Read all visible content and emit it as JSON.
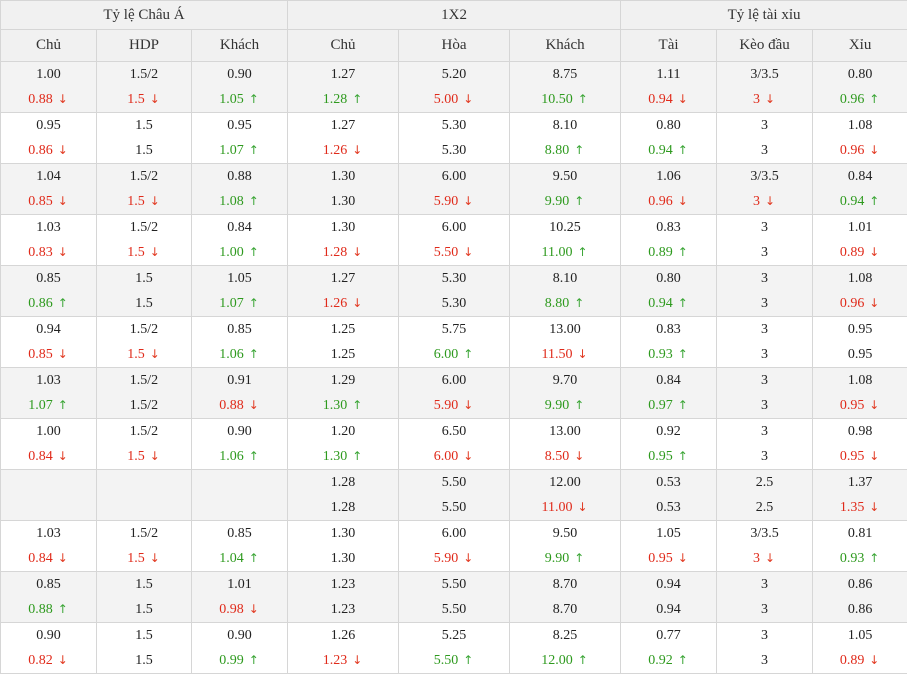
{
  "groups": [
    "Tỷ lệ Châu Á",
    "1X2",
    "Tỷ lệ tài xỉu"
  ],
  "columns": [
    "Chủ",
    "HDP",
    "Khách",
    "Chủ",
    "Hòa",
    "Khách",
    "Tài",
    "Kèo đầu",
    "Xỉu"
  ],
  "colors": {
    "up": "#2e9a1e",
    "down": "#e02a1a",
    "header_bg": "#f1f1f1",
    "row_shade": "#f3f3f3",
    "border": "#d6d6d6"
  },
  "rows": [
    {
      "cells": [
        [
          "1.00",
          "0.88",
          "down"
        ],
        [
          "1.5/2",
          "1.5",
          "down"
        ],
        [
          "0.90",
          "1.05",
          "up"
        ],
        [
          "1.27",
          "1.28",
          "up"
        ],
        [
          "5.20",
          "5.00",
          "down"
        ],
        [
          "8.75",
          "10.50",
          "up"
        ],
        [
          "1.11",
          "0.94",
          "down"
        ],
        [
          "3/3.5",
          "3",
          "down"
        ],
        [
          "0.80",
          "0.96",
          "up"
        ]
      ]
    },
    {
      "cells": [
        [
          "0.95",
          "0.86",
          "down"
        ],
        [
          "1.5",
          "1.5",
          ""
        ],
        [
          "0.95",
          "1.07",
          "up"
        ],
        [
          "1.27",
          "1.26",
          "down"
        ],
        [
          "5.30",
          "5.30",
          ""
        ],
        [
          "8.10",
          "8.80",
          "up"
        ],
        [
          "0.80",
          "0.94",
          "up"
        ],
        [
          "3",
          "3",
          ""
        ],
        [
          "1.08",
          "0.96",
          "down"
        ]
      ]
    },
    {
      "cells": [
        [
          "1.04",
          "0.85",
          "down"
        ],
        [
          "1.5/2",
          "1.5",
          "down"
        ],
        [
          "0.88",
          "1.08",
          "up"
        ],
        [
          "1.30",
          "1.30",
          ""
        ],
        [
          "6.00",
          "5.90",
          "down"
        ],
        [
          "9.50",
          "9.90",
          "up"
        ],
        [
          "1.06",
          "0.96",
          "down"
        ],
        [
          "3/3.5",
          "3",
          "down"
        ],
        [
          "0.84",
          "0.94",
          "up"
        ]
      ]
    },
    {
      "cells": [
        [
          "1.03",
          "0.83",
          "down"
        ],
        [
          "1.5/2",
          "1.5",
          "down"
        ],
        [
          "0.84",
          "1.00",
          "up"
        ],
        [
          "1.30",
          "1.28",
          "down"
        ],
        [
          "6.00",
          "5.50",
          "down"
        ],
        [
          "10.25",
          "11.00",
          "up"
        ],
        [
          "0.83",
          "0.89",
          "up"
        ],
        [
          "3",
          "3",
          ""
        ],
        [
          "1.01",
          "0.89",
          "down"
        ]
      ]
    },
    {
      "cells": [
        [
          "0.85",
          "0.86",
          "up"
        ],
        [
          "1.5",
          "1.5",
          ""
        ],
        [
          "1.05",
          "1.07",
          "up"
        ],
        [
          "1.27",
          "1.26",
          "down"
        ],
        [
          "5.30",
          "5.30",
          ""
        ],
        [
          "8.10",
          "8.80",
          "up"
        ],
        [
          "0.80",
          "0.94",
          "up"
        ],
        [
          "3",
          "3",
          ""
        ],
        [
          "1.08",
          "0.96",
          "down"
        ]
      ]
    },
    {
      "cells": [
        [
          "0.94",
          "0.85",
          "down"
        ],
        [
          "1.5/2",
          "1.5",
          "down"
        ],
        [
          "0.85",
          "1.06",
          "up"
        ],
        [
          "1.25",
          "1.25",
          ""
        ],
        [
          "5.75",
          "6.00",
          "up"
        ],
        [
          "13.00",
          "11.50",
          "down"
        ],
        [
          "0.83",
          "0.93",
          "up"
        ],
        [
          "3",
          "3",
          ""
        ],
        [
          "0.95",
          "0.95",
          ""
        ]
      ]
    },
    {
      "cells": [
        [
          "1.03",
          "1.07",
          "up"
        ],
        [
          "1.5/2",
          "1.5/2",
          ""
        ],
        [
          "0.91",
          "0.88",
          "down"
        ],
        [
          "1.29",
          "1.30",
          "up"
        ],
        [
          "6.00",
          "5.90",
          "down"
        ],
        [
          "9.70",
          "9.90",
          "up"
        ],
        [
          "0.84",
          "0.97",
          "up"
        ],
        [
          "3",
          "3",
          ""
        ],
        [
          "1.08",
          "0.95",
          "down"
        ]
      ]
    },
    {
      "cells": [
        [
          "1.00",
          "0.84",
          "down"
        ],
        [
          "1.5/2",
          "1.5",
          "down"
        ],
        [
          "0.90",
          "1.06",
          "up"
        ],
        [
          "1.20",
          "1.30",
          "up"
        ],
        [
          "6.50",
          "6.00",
          "down"
        ],
        [
          "13.00",
          "8.50",
          "down"
        ],
        [
          "0.92",
          "0.95",
          "up"
        ],
        [
          "3",
          "3",
          ""
        ],
        [
          "0.98",
          "0.95",
          "down"
        ]
      ]
    },
    {
      "cells": [
        [
          "",
          "",
          ""
        ],
        [
          "",
          "",
          ""
        ],
        [
          "",
          "",
          ""
        ],
        [
          "1.28",
          "1.28",
          ""
        ],
        [
          "5.50",
          "5.50",
          ""
        ],
        [
          "12.00",
          "11.00",
          "down"
        ],
        [
          "0.53",
          "0.53",
          ""
        ],
        [
          "2.5",
          "2.5",
          ""
        ],
        [
          "1.37",
          "1.35",
          "down"
        ]
      ]
    },
    {
      "cells": [
        [
          "1.03",
          "0.84",
          "down"
        ],
        [
          "1.5/2",
          "1.5",
          "down"
        ],
        [
          "0.85",
          "1.04",
          "up"
        ],
        [
          "1.30",
          "1.30",
          ""
        ],
        [
          "6.00",
          "5.90",
          "down"
        ],
        [
          "9.50",
          "9.90",
          "up"
        ],
        [
          "1.05",
          "0.95",
          "down"
        ],
        [
          "3/3.5",
          "3",
          "down"
        ],
        [
          "0.81",
          "0.93",
          "up"
        ]
      ]
    },
    {
      "cells": [
        [
          "0.85",
          "0.88",
          "up"
        ],
        [
          "1.5",
          "1.5",
          ""
        ],
        [
          "1.01",
          "0.98",
          "down"
        ],
        [
          "1.23",
          "1.23",
          ""
        ],
        [
          "5.50",
          "5.50",
          ""
        ],
        [
          "8.70",
          "8.70",
          ""
        ],
        [
          "0.94",
          "0.94",
          ""
        ],
        [
          "3",
          "3",
          ""
        ],
        [
          "0.86",
          "0.86",
          ""
        ]
      ]
    },
    {
      "cells": [
        [
          "0.90",
          "0.82",
          "down"
        ],
        [
          "1.5",
          "1.5",
          ""
        ],
        [
          "0.90",
          "0.99",
          "up"
        ],
        [
          "1.26",
          "1.23",
          "down"
        ],
        [
          "5.25",
          "5.50",
          "up"
        ],
        [
          "8.25",
          "12.00",
          "up"
        ],
        [
          "0.77",
          "0.92",
          "up"
        ],
        [
          "3",
          "3",
          ""
        ],
        [
          "1.05",
          "0.89",
          "down"
        ]
      ]
    }
  ]
}
